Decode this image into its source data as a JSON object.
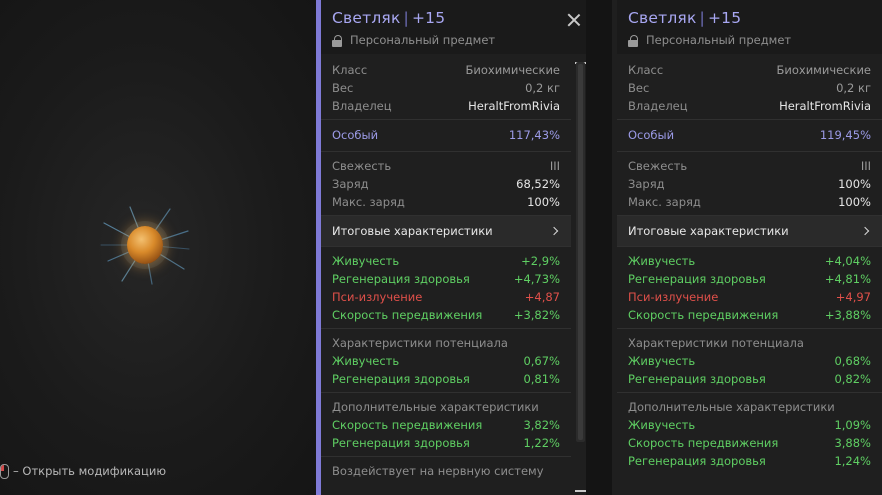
{
  "viewer": {
    "hint_text": "– Открыть модификацию"
  },
  "left_panel": {
    "title": "Светляк",
    "level": "+15",
    "subtitle": "Персональный предмет",
    "info": [
      {
        "k": "Класс",
        "v": "Биохимические"
      },
      {
        "k": "Вес",
        "v": "0,2 кг"
      },
      {
        "k": "Владелец",
        "v": "HeraltFromRivia"
      }
    ],
    "special": {
      "k": "Особый",
      "v": "117,43%"
    },
    "state": [
      {
        "k": "Свежесть",
        "v": "III"
      },
      {
        "k": "Заряд",
        "v": "68,52%"
      },
      {
        "k": "Макс. заряд",
        "v": "100%"
      }
    ],
    "summary_label": "Итоговые характеристики",
    "totals": [
      {
        "k": "Живучесть",
        "v": "+2,9%"
      },
      {
        "k": "Регенерация здоровья",
        "v": "+4,73%"
      },
      {
        "k": "Пси-излучение",
        "v": "+4,87"
      },
      {
        "k": "Скорость передвижения",
        "v": "+3,82%"
      }
    ],
    "potential_title": "Характеристики потенциала",
    "potential": [
      {
        "k": "Живучесть",
        "v": "0,67%"
      },
      {
        "k": "Регенерация здоровья",
        "v": "0,81%"
      }
    ],
    "extra_title": "Дополнительные характеристики",
    "extra": [
      {
        "k": "Скорость передвижения",
        "v": "3,82%"
      },
      {
        "k": "Регенерация здоровья",
        "v": "1,22%"
      }
    ],
    "footer_text": "Воздействует на нервную систему"
  },
  "right_panel": {
    "title": "Светляк",
    "level": "+15",
    "subtitle": "Персональный предмет",
    "info": [
      {
        "k": "Класс",
        "v": "Биохимические"
      },
      {
        "k": "Вес",
        "v": "0,2 кг"
      },
      {
        "k": "Владелец",
        "v": "HeraltFromRivia"
      }
    ],
    "special": {
      "k": "Особый",
      "v": "119,45%"
    },
    "state": [
      {
        "k": "Свежесть",
        "v": "III"
      },
      {
        "k": "Заряд",
        "v": "100%"
      },
      {
        "k": "Макс. заряд",
        "v": "100%"
      }
    ],
    "summary_label": "Итоговые характеристики",
    "totals": [
      {
        "k": "Живучесть",
        "v": "+4,04%"
      },
      {
        "k": "Регенерация здоровья",
        "v": "+4,81%"
      },
      {
        "k": "Пси-излучение",
        "v": "+4,97"
      },
      {
        "k": "Скорость передвижения",
        "v": "+3,88%"
      }
    ],
    "potential_title": "Характеристики потенциала",
    "potential": [
      {
        "k": "Живучесть",
        "v": "0,68%"
      },
      {
        "k": "Регенерация здоровья",
        "v": "0,82%"
      }
    ],
    "extra_title": "Дополнительные характеристики",
    "extra": [
      {
        "k": "Живучесть",
        "v": "1,09%"
      },
      {
        "k": "Скорость передвижения",
        "v": "3,88%"
      },
      {
        "k": "Регенерация здоровья",
        "v": "1,24%"
      }
    ]
  },
  "colors": {
    "accent": "#a8a7f2",
    "positive": "#5fcf63",
    "negative": "#e0504a",
    "special": "#9c9be8",
    "panel_bg": "#1f1f1f"
  }
}
